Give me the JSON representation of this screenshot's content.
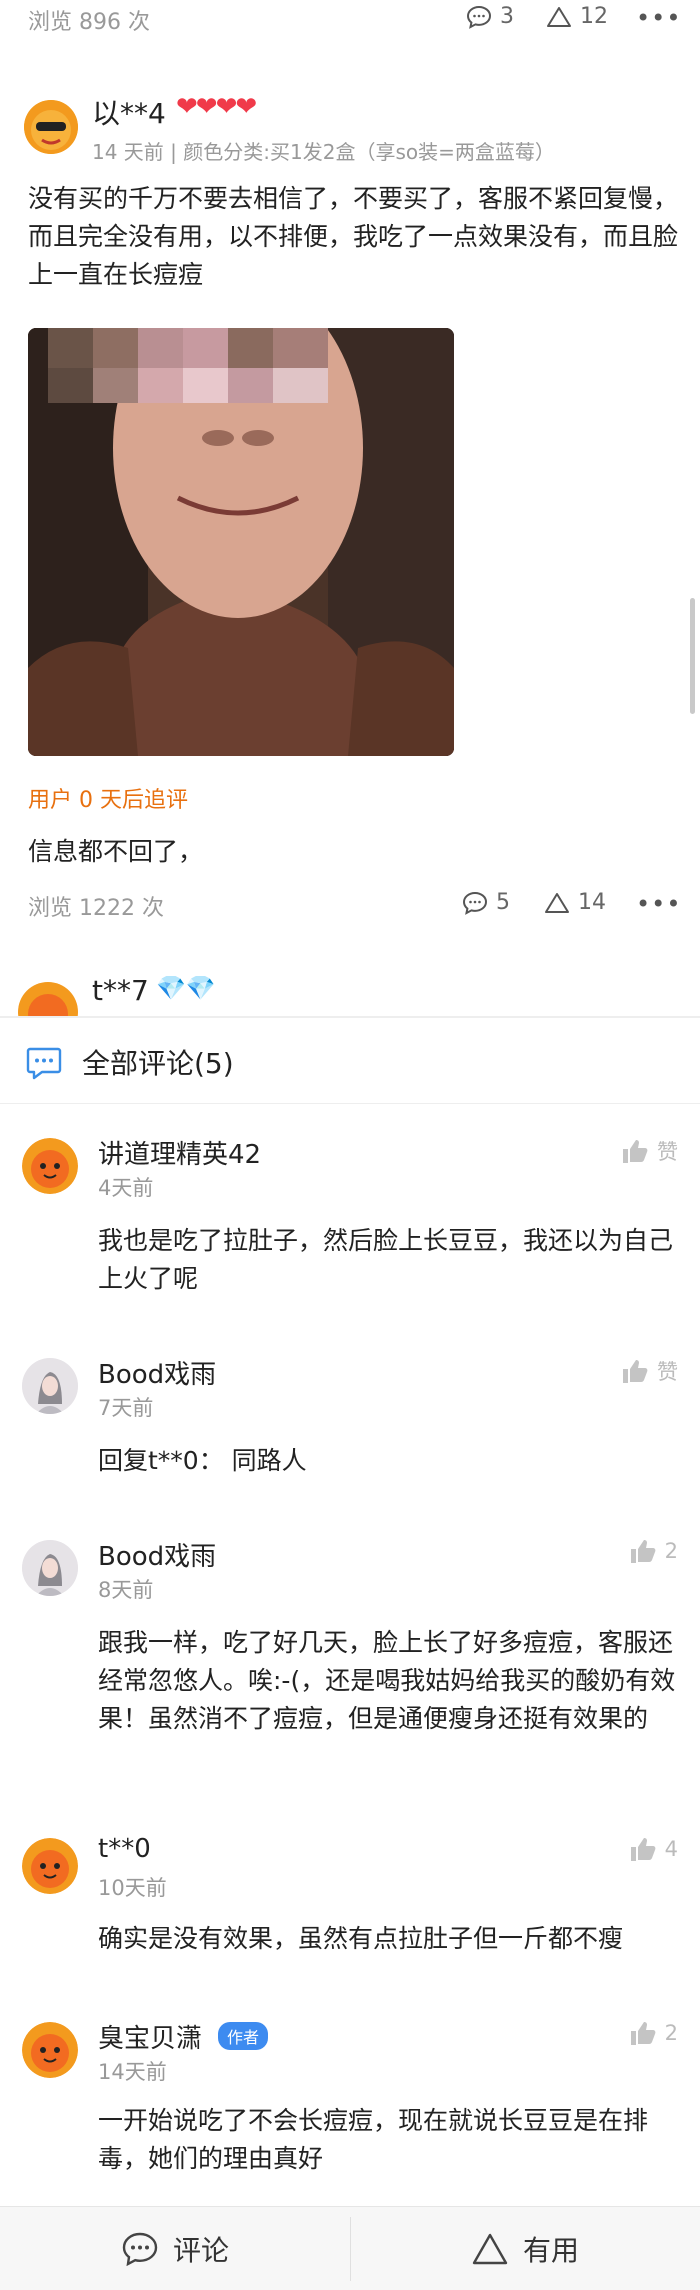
{
  "top_stats": {
    "views": "浏览 896 次",
    "comments": "3",
    "useful": "12"
  },
  "review1": {
    "username": "以**4",
    "hearts": "❤❤❤❤",
    "meta": "14 天前 | 颜色分类:买1发2盒（享so装=两盒蓝莓）",
    "text": "没有买的千万不要去相信了，不要买了，客服不紧回复慢，而且完全没有用，以不排便，我吃了一点效果没有，而且脸上一直在长痘痘",
    "followup_label": "用户 0 天后追评",
    "followup_text": "信息都不回了，",
    "views": "浏览 1222 次",
    "comments": "5",
    "useful": "14"
  },
  "review2": {
    "username": "t**7",
    "diamonds": "💎💎"
  },
  "comments_sheet": {
    "title": "全部评论(5)",
    "like_text": "赞",
    "author_badge": "作者",
    "items": [
      {
        "name": "讲道理精英42",
        "time": "4天前",
        "text": "我也是吃了拉肚子，然后脸上长豆豆，我还以为自己上火了呢",
        "likes": "赞"
      },
      {
        "name": "Bood戏雨",
        "time": "7天前",
        "text": "回复t**0：  同路人",
        "likes": "赞"
      },
      {
        "name": "Bood戏雨",
        "time": "8天前",
        "text": "跟我一样，吃了好几天，脸上长了好多痘痘，客服还经常忽悠人。唉:-(，还是喝我姑妈给我买的酸奶有效果！虽然消不了痘痘，但是通便瘦身还挺有效果的",
        "likes": "2"
      },
      {
        "name": "t**0",
        "time": "10天前",
        "text": "确实是没有效果，虽然有点拉肚子但一斤都不瘦",
        "likes": "4"
      },
      {
        "name": "臭宝贝潇",
        "time": "14天前",
        "text": "一开始说吃了不会长痘痘，现在就说长豆豆是在排毒，她们的理由真好",
        "likes": "2"
      }
    ]
  },
  "bottom_bar": {
    "comment_label": "评论",
    "useful_label": "有用"
  },
  "colors": {
    "accent_orange": "#e8700f",
    "heart_red": "#f03a4a",
    "badge_blue": "#3d8bf0",
    "icon_blue": "#3a8ee6"
  }
}
